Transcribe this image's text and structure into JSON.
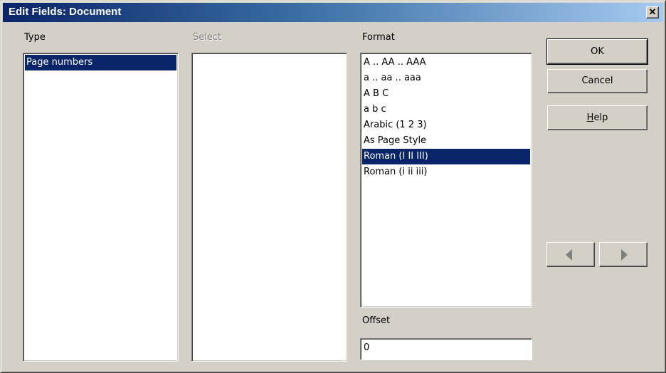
{
  "window": {
    "title": "Edit Fields: Document",
    "close_glyph": "✕"
  },
  "type_panel": {
    "label": "Type",
    "items": [
      "Page numbers"
    ],
    "selected_index": 0
  },
  "select_panel": {
    "label": "Select",
    "disabled": true,
    "items": []
  },
  "format_panel": {
    "label": "Format",
    "items": [
      "A .. AA .. AAA",
      "a .. aa .. aaa",
      "A B C",
      "a b c",
      "Arabic (1 2 3)",
      "As Page Style",
      "Roman (I II III)",
      "Roman (i ii iii)"
    ],
    "selected_index": 6
  },
  "offset": {
    "label": "Offset",
    "value": "0"
  },
  "buttons": {
    "ok": "OK",
    "cancel": "Cancel",
    "help": "Help"
  },
  "colors": {
    "selection": "#0a246a",
    "face": "#d4d0c8"
  }
}
